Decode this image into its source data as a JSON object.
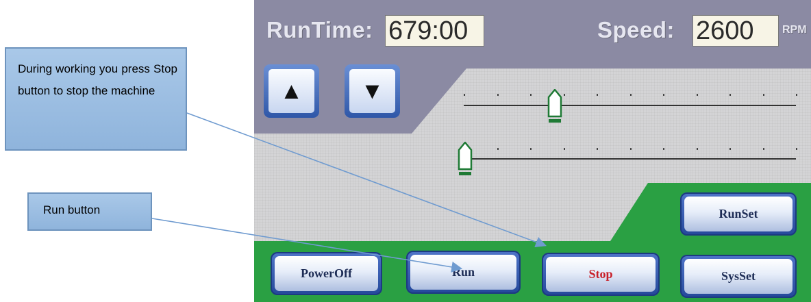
{
  "callouts": {
    "stop_note": "During working you press Stop button to stop the machine",
    "run_note": "Run button"
  },
  "header": {
    "runtime_label": "RunTime:",
    "runtime_value": "679:00",
    "speed_label": "Speed:",
    "speed_value": "2600",
    "speed_unit": "RPM"
  },
  "arrows": {
    "up": "▲",
    "down": "▼"
  },
  "sliders": {
    "upper_position": 0.27,
    "lower_position": 0.0
  },
  "buttons": {
    "poweroff": "PowerOff",
    "run": "Run",
    "stop": "Stop",
    "sysset": "SysSet",
    "runset": "RunSet"
  },
  "colors": {
    "panel_green": "#2aa043",
    "header_slate": "#8b8aa3",
    "stop_text": "#c81f28",
    "button_blue": "#2f57a8",
    "callout_blue": "#9ebfe3"
  }
}
